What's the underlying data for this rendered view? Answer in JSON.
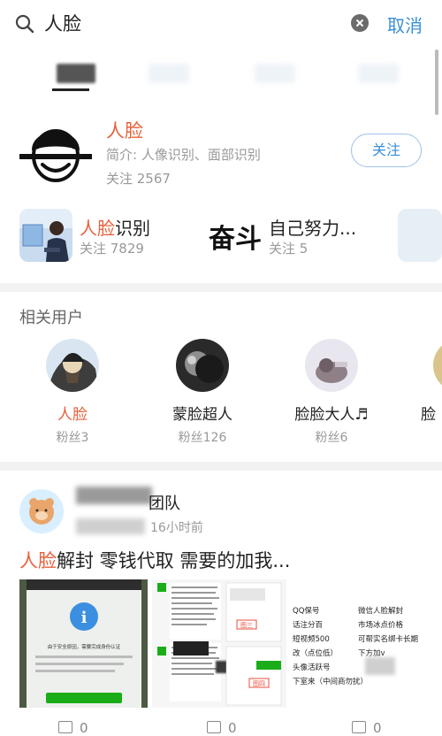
{
  "search": {
    "query": "人脸",
    "cancel_label": "取消"
  },
  "topic": {
    "title": "人脸",
    "intro": "简介: 人像识别、面部识别",
    "follow_count": "关注 2567",
    "follow_label": "关注"
  },
  "related_topics": [
    {
      "name_highlight": "人脸",
      "name_rest": "识别",
      "count": "关注 7829"
    },
    {
      "name_highlight": "",
      "name_rest": "自己努力...",
      "count": "关注 5",
      "thumb_text": "奋斗"
    }
  ],
  "related_users": {
    "title": "相关用户",
    "users": [
      {
        "name": "人脸",
        "fans": "粉丝3",
        "highlight": true
      },
      {
        "name": "蒙脸超人",
        "fans": "粉丝126",
        "highlight": false
      },
      {
        "name": "脸脸大人♬",
        "fans": "粉丝6",
        "highlight": false
      },
      {
        "name": "脸",
        "fans": "",
        "highlight": false
      }
    ]
  },
  "post": {
    "author_suffix": "团队",
    "time": "16小时前",
    "title_highlight": "人脸",
    "title_rest": "解封 零钱代取 需要的加我...",
    "img1_text": "由于安全原因，需要完成身份认证",
    "img2_labels": [
      "图三",
      "图四"
    ],
    "img3_rows": [
      [
        "QQ保号",
        "微信人脸解封"
      ],
      [
        "话注分百",
        "市场冰点价格"
      ],
      [
        "短视频500",
        "可帮实名绑卡长期"
      ],
      [
        "改（点位低）",
        "下方加v"
      ],
      [
        "头像活跃号",
        ""
      ],
      [
        "下室来（中间商勿扰）",
        ""
      ]
    ]
  },
  "actions": {
    "share": "0",
    "comment": "0",
    "like": "0"
  },
  "colors": {
    "accent": "#e8613c",
    "link": "#3a8fd6"
  }
}
